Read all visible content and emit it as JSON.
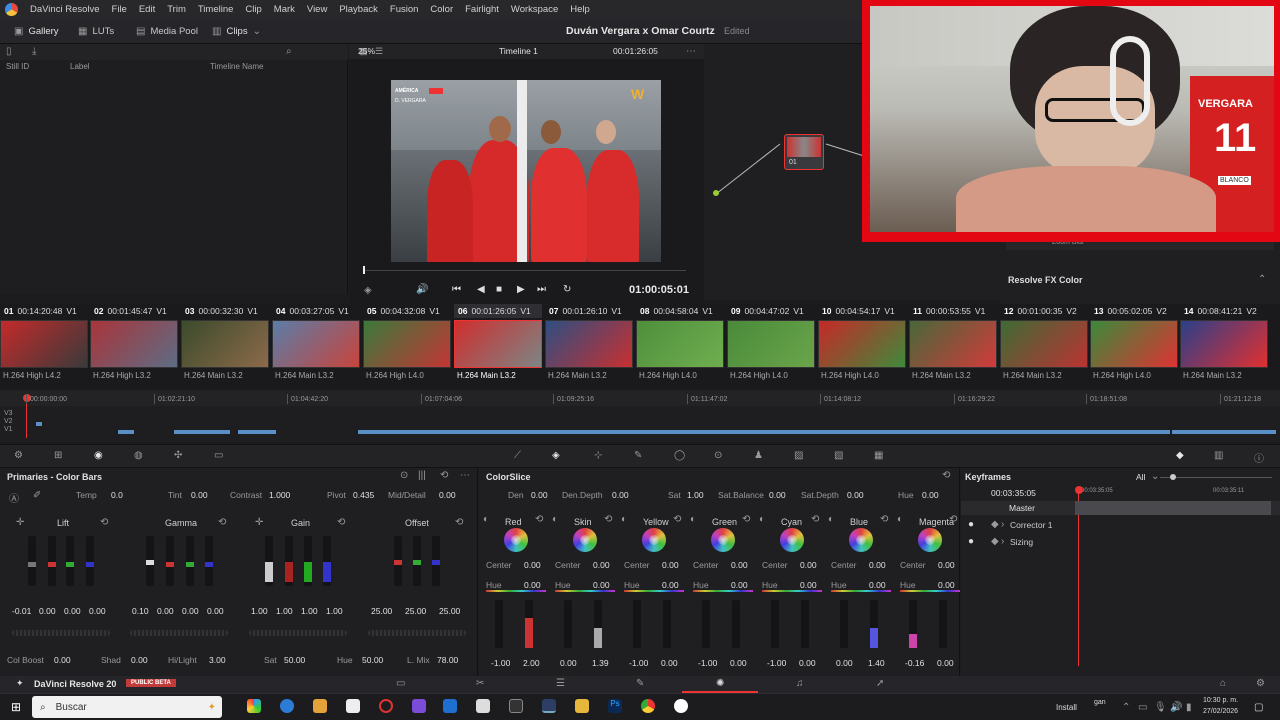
{
  "menu": {
    "app": "DaVinci Resolve",
    "items": [
      "File",
      "Edit",
      "Trim",
      "Timeline",
      "Clip",
      "Mark",
      "View",
      "Playback",
      "Fusion",
      "Color",
      "Fairlight",
      "Workspace",
      "Help"
    ]
  },
  "toolbar": {
    "gallery": "Gallery",
    "luts": "LUTs",
    "media_pool": "Media Pool",
    "clips": "Clips",
    "zoom": "25%",
    "timeline": "Timeline 1",
    "tc": "00:01:26:05"
  },
  "project": {
    "title": "Duván Vergara x Omar Courtz",
    "status": "Edited"
  },
  "gallery": {
    "cols": [
      "Still ID",
      "Label",
      "Timeline Name"
    ]
  },
  "viewer": {
    "timecode": "01:00:05:01",
    "overlay_team": "AMÉRICA",
    "overlay_player": "D. VERGARA"
  },
  "nodes": {
    "node_label": "01"
  },
  "fx": {
    "zoom_blur": "Zoom Blur",
    "resolve_fx": "Resolve FX Color"
  },
  "camera": {
    "shirt_text": "VERGARA",
    "shirt_num": "11",
    "sleeve": "BLANCO"
  },
  "clips": [
    {
      "n": "01",
      "tc": "00:14:20:48",
      "tr": "V1",
      "codec": "H.264 High L4.2",
      "c1": "#c42a2a",
      "c2": "#3a3a3a"
    },
    {
      "n": "02",
      "tc": "00:01:45:47",
      "tr": "V1",
      "codec": "H.264 High L3.2",
      "c1": "#a9353a",
      "c2": "#5d6c85"
    },
    {
      "n": "03",
      "tc": "00:00:32:30",
      "tr": "V1",
      "codec": "H.264 Main L3.2",
      "c1": "#3b4b2c",
      "c2": "#8c6a4a"
    },
    {
      "n": "04",
      "tc": "00:03:27:05",
      "tr": "V1",
      "codec": "H.264 Main L3.2",
      "c1": "#5a7da8",
      "c2": "#c8443c"
    },
    {
      "n": "05",
      "tc": "00:04:32:08",
      "tr": "V1",
      "codec": "H.264 High L4.0",
      "c1": "#3b7a3b",
      "c2": "#c33636"
    },
    {
      "n": "06",
      "tc": "00:01:26:05",
      "tr": "V1",
      "codec": "H.264 Main L3.2",
      "c1": "#cf2e2e",
      "c2": "#7d8585"
    },
    {
      "n": "07",
      "tc": "00:01:26:10",
      "tr": "V1",
      "codec": "H.264 Main L3.2",
      "c1": "#2e4e82",
      "c2": "#c83030"
    },
    {
      "n": "08",
      "tc": "00:04:58:04",
      "tr": "V1",
      "codec": "H.264 High L4.0",
      "c1": "#4f8f3c",
      "c2": "#6fae4f"
    },
    {
      "n": "09",
      "tc": "00:04:47:02",
      "tr": "V1",
      "codec": "H.264 High L4.0",
      "c1": "#4a8a3a",
      "c2": "#6aa54a"
    },
    {
      "n": "10",
      "tc": "00:04:54:17",
      "tr": "V1",
      "codec": "H.264 High L4.0",
      "c1": "#c62828",
      "c2": "#3f8a3a"
    },
    {
      "n": "11",
      "tc": "00:00:53:55",
      "tr": "V1",
      "codec": "H.264 Main L3.2",
      "c1": "#47683a",
      "c2": "#d23b3b"
    },
    {
      "n": "12",
      "tc": "00:01:00:35",
      "tr": "V2",
      "codec": "H.264 Main L3.2",
      "c1": "#3e6b35",
      "c2": "#b33"
    },
    {
      "n": "13",
      "tc": "00:05:02:05",
      "tr": "V2",
      "codec": "H.264 High L4.0",
      "c1": "#3b8a3b",
      "c2": "#d33"
    },
    {
      "n": "14",
      "tc": "00:08:41:21",
      "tr": "V2",
      "codec": "H.264 Main L3.2",
      "c1": "#2a3f8a",
      "c2": "#e23030"
    }
  ],
  "minitl": {
    "ruler": [
      "00:00:00:00",
      "01:02:21:10",
      "01:04:42:20",
      "01:07:04:06",
      "01:09:25:16",
      "01:11:47:02",
      "01:14:08:12",
      "01:16:29:22",
      "01:18:51:08",
      "01:21:12:18"
    ],
    "tracks": [
      "V3",
      "V2",
      "V1"
    ]
  },
  "primaries": {
    "title": "Primaries - Color Bars",
    "temp_l": "Temp",
    "temp": "0.0",
    "tint_l": "Tint",
    "tint": "0.00",
    "contrast_l": "Contrast",
    "contrast": "1.000",
    "pivot_l": "Pivot",
    "pivot": "0.435",
    "md_l": "Mid/Detail",
    "md": "0.00",
    "wheels": [
      {
        "name": "Lift",
        "vals": [
          "-0.01",
          "0.00",
          "0.00",
          "0.00"
        ]
      },
      {
        "name": "Gamma",
        "vals": [
          "0.10",
          "0.00",
          "0.00",
          "0.00"
        ]
      },
      {
        "name": "Gain",
        "vals": [
          "1.00",
          "1.00",
          "1.00",
          "1.00"
        ]
      },
      {
        "name": "Offset",
        "vals": [
          "25.00",
          "25.00",
          "25.00"
        ]
      }
    ],
    "boost_l": "Col Boost",
    "boost": "0.00",
    "shad_l": "Shad",
    "shad": "0.00",
    "hl_l": "Hi/Light",
    "hl": "3.00",
    "sat_l": "Sat",
    "sat": "50.00",
    "hue_l": "Hue",
    "hue": "50.00",
    "lmix_l": "L. Mix",
    "lmix": "78.00"
  },
  "colorslice": {
    "title": "ColorSlice",
    "den_l": "Den",
    "den": "0.00",
    "dd_l": "Den.Depth",
    "dd": "0.00",
    "sat_l": "Sat",
    "sat": "1.00",
    "sb_l": "Sat.Balance",
    "sb": "0.00",
    "sd_l": "Sat.Depth",
    "sd": "0.00",
    "hue_l": "Hue",
    "hue": "0.00",
    "vectors": [
      {
        "name": "Red",
        "center": "0.00",
        "hue": "0.00",
        "b1": "-1.00",
        "b2": "2.00"
      },
      {
        "name": "Skin",
        "center": "0.00",
        "hue": "0.00",
        "b1": "0.00",
        "b2": "1.39"
      },
      {
        "name": "Yellow",
        "center": "0.00",
        "hue": "0.00",
        "b1": "-1.00",
        "b2": "0.00"
      },
      {
        "name": "Green",
        "center": "0.00",
        "hue": "0.00",
        "b1": "-1.00",
        "b2": "0.00"
      },
      {
        "name": "Cyan",
        "center": "0.00",
        "hue": "0.00",
        "b1": "-1.00",
        "b2": "0.00"
      },
      {
        "name": "Blue",
        "center": "0.00",
        "hue": "0.00",
        "b1": "0.00",
        "b2": "1.40"
      },
      {
        "name": "Magenta",
        "center": "0.00",
        "hue": "0.00",
        "b1": "-0.16",
        "b2": "0.00"
      }
    ],
    "center_l": "Center",
    "hue_l2": "Hue"
  },
  "keyframes": {
    "title": "Keyframes",
    "filter": "All",
    "tc": "00:03:35:05",
    "tc2": "00:03:35:11",
    "tc_mid": "00:03:35:05",
    "rows": [
      "Master",
      "Corrector 1",
      "Sizing"
    ]
  },
  "pagebar": {
    "app": "DaVinci Resolve 20",
    "badge": "PUBLIC BETA"
  },
  "taskbar": {
    "search": "Buscar",
    "install": "Install",
    "time": "10:30 p. m.",
    "date": "27/02/2026",
    "tray": "gan"
  }
}
